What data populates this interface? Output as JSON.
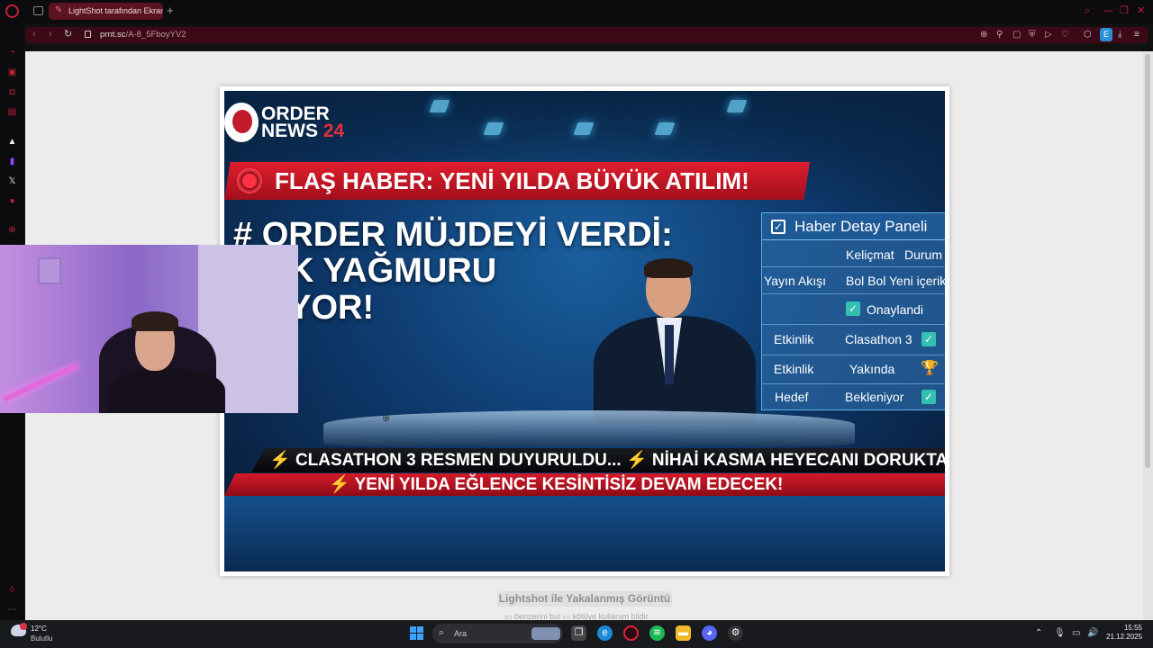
{
  "browser": {
    "tab_title": "LightShot tarafından Ekran",
    "url_host": "prnt.sc",
    "url_path": "/A-8_5FboyYV2",
    "extension_label": "E"
  },
  "news": {
    "logo_line1": "ORDER",
    "logo_line2": "NEWS",
    "logo_number": "24",
    "flash": "FLAŞ HABER: YENİ YILDA BÜYÜK ATILIM!",
    "headline1": "# ORDER MÜJDEYİ VERDİ:",
    "headline2": "RİK YAĞMURU",
    "headline3": "ŞLIYOR!",
    "panel": {
      "title": "Haber Detay Paneli",
      "col1": "Keliçmat",
      "col2": "Durum",
      "r1a": "Yayın Akışı",
      "r1b": "Bol Bol Yeni içerik",
      "r2b": "Onaylandi",
      "r3a": "Etkinlik",
      "r3b": "Clasathon 3",
      "r4a": "Etkinlik",
      "r4b": "Yakında",
      "r5a": "Hedef",
      "r5b": "Bekleniyor"
    },
    "ticker1a": "CLASATHON 3 RESMEN DUYURULDU...",
    "ticker1b": "NİHAİ KASMA HEYECANI DORUKTA!",
    "ticker2": "YENİ YILDA EĞLENCE KESİNTİSİZ DEVAM EDECEK!"
  },
  "page": {
    "caption": "Lightshot ile Yakalanmış Görüntü",
    "link1": "benzerini bul",
    "link2": "kötüye kullanım bildir"
  },
  "taskbar": {
    "temperature": "12°C",
    "condition": "Bulutlu",
    "search_label": "Ara",
    "time": "15:55",
    "date": "21.12.2025"
  }
}
